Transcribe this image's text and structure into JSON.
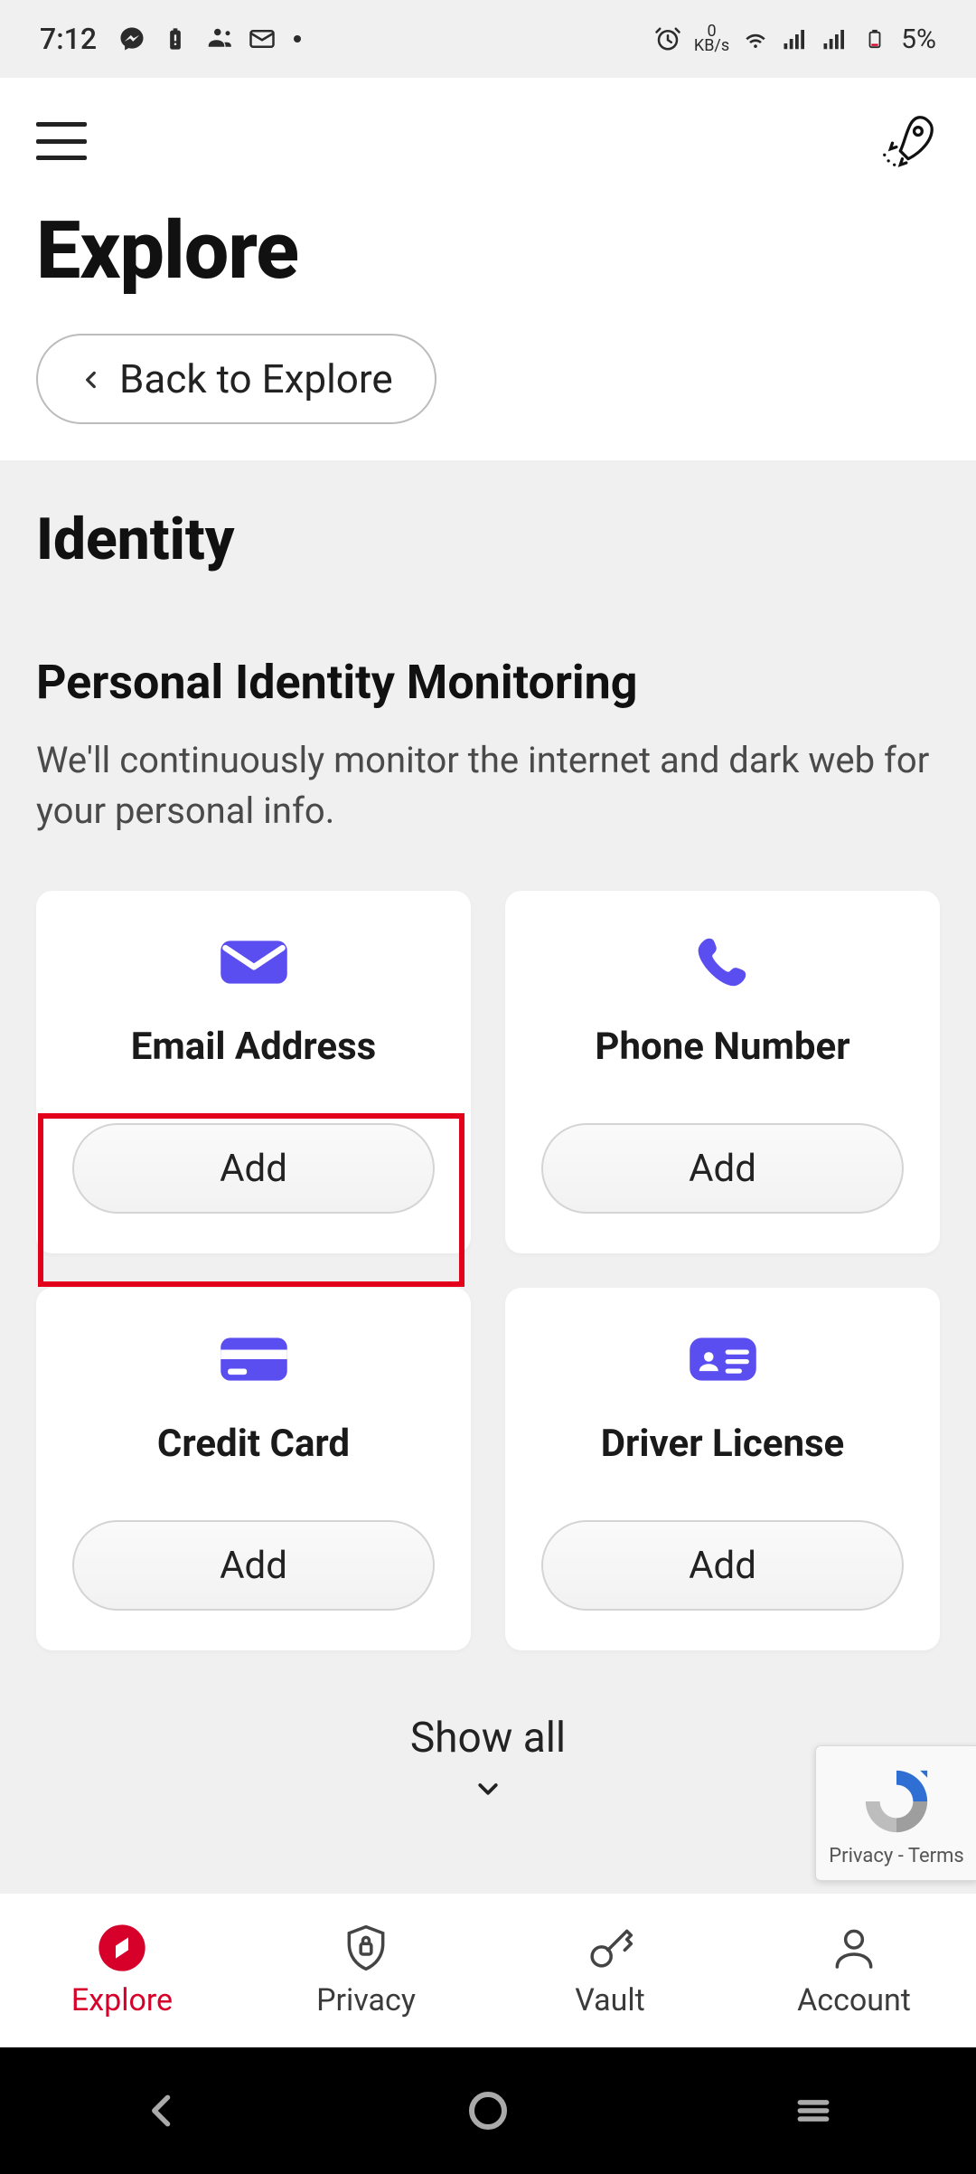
{
  "status": {
    "time": "7:12",
    "kbs_top": "0",
    "kbs_bot": "KB/s",
    "battery": "5%"
  },
  "header": {
    "title": "Explore",
    "back_label": "Back to Explore"
  },
  "identity": {
    "title": "Identity",
    "pim_title": "Personal Identity Monitoring",
    "pim_desc": "We'll continuously monitor the internet and dark web for your personal info."
  },
  "cards": {
    "email": {
      "title": "Email Address",
      "button": "Add"
    },
    "phone": {
      "title": "Phone Number",
      "button": "Add"
    },
    "credit": {
      "title": "Credit Card",
      "button": "Add"
    },
    "driver": {
      "title": "Driver License",
      "button": "Add"
    }
  },
  "show_all": "Show all",
  "recaptcha": {
    "privacy": "Privacy",
    "sep": " - ",
    "terms": "Terms"
  },
  "tabs": {
    "explore": "Explore",
    "privacy": "Privacy",
    "vault": "Vault",
    "account": "Account"
  }
}
